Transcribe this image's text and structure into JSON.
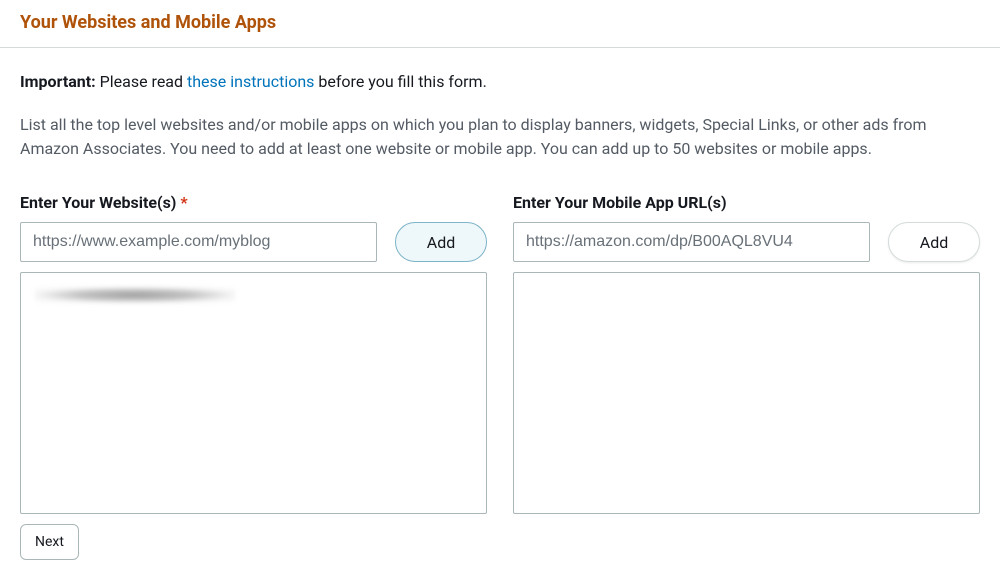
{
  "header": {
    "title": "Your Websites and Mobile Apps"
  },
  "important": {
    "label": "Important:",
    "prefix": " Please read ",
    "link": "these instructions",
    "suffix": " before you fill this form."
  },
  "description": "List all the top level websites and/or mobile apps on which you plan to display banners, widgets, Special Links, or other ads from Amazon Associates. You need to add at least one website or mobile app. You can add up to 50 websites or mobile apps.",
  "websites": {
    "label": "Enter Your Website(s)",
    "required_marker": "*",
    "placeholder": "https://www.example.com/myblog",
    "add_label": "Add"
  },
  "apps": {
    "label": "Enter Your Mobile App URL(s)",
    "placeholder": "https://amazon.com/dp/B00AQL8VU4",
    "add_label": "Add"
  },
  "footer": {
    "next_label": "Next"
  }
}
